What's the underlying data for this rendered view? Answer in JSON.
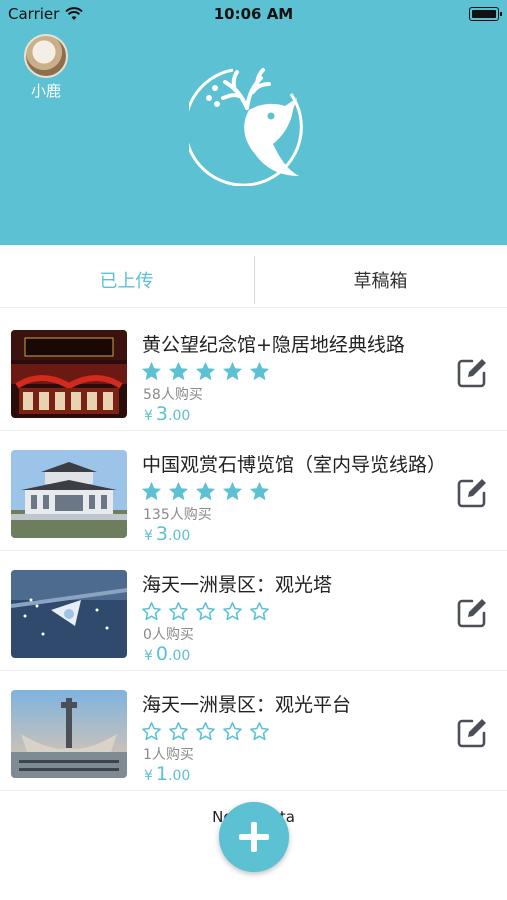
{
  "status_bar": {
    "carrier": "Carrier",
    "time": "10:06 AM"
  },
  "profile": {
    "name": "小鹿"
  },
  "tabs": [
    {
      "label": "已上传",
      "active": true
    },
    {
      "label": "草稿箱",
      "active": false
    }
  ],
  "items": [
    {
      "title": "黄公望纪念馆+隐居地经典线路",
      "rating": 5,
      "buyers": "58人购买",
      "price_currency": "¥",
      "price_int": "3",
      "price_dec": ".00"
    },
    {
      "title": "中国观赏石博览馆（室内导览线路）",
      "rating": 5,
      "buyers": "135人购买",
      "price_currency": "¥",
      "price_int": "3",
      "price_dec": ".00"
    },
    {
      "title": "海天一洲景区：观光塔",
      "rating": 0,
      "buyers": "0人购买",
      "price_currency": "¥",
      "price_int": "0",
      "price_dec": ".00"
    },
    {
      "title": "海天一洲景区：观光平台",
      "rating": 0,
      "buyers": "1人购买",
      "price_currency": "¥",
      "price_int": "1",
      "price_dec": ".00"
    }
  ],
  "footer": {
    "text": "No      data"
  },
  "icons": {
    "add": "plus-icon",
    "edit": "edit-icon",
    "star": "star-icon",
    "wifi": "wifi-icon",
    "logo": "deer-logo-icon"
  },
  "colors": {
    "accent": "#5bc1d3",
    "star_filled": "#5bc1d3",
    "edit_icon": "#4a4f58"
  }
}
